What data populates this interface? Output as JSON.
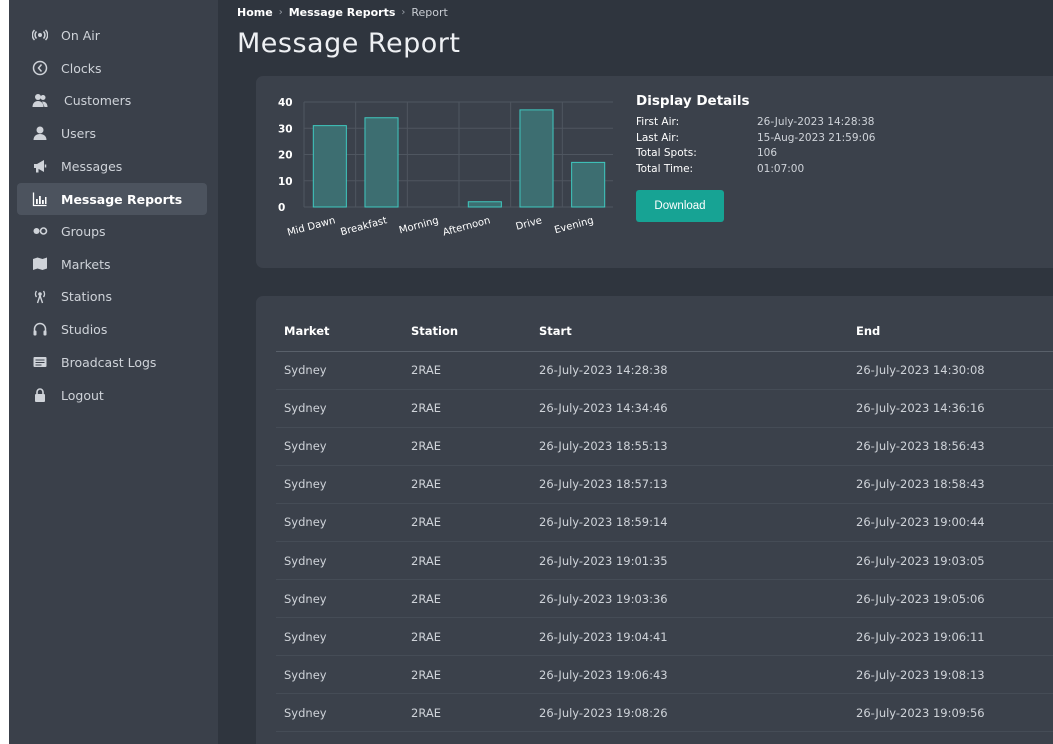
{
  "sidebar": {
    "items": [
      {
        "label": "On Air",
        "icon": "broadcast-icon"
      },
      {
        "label": "Clocks",
        "icon": "clock-icon"
      },
      {
        "label": "Customers",
        "icon": "customers-icon"
      },
      {
        "label": "Users",
        "icon": "user-icon"
      },
      {
        "label": "Messages",
        "icon": "megaphone-icon"
      },
      {
        "label": "Message Reports",
        "icon": "report-chart-icon",
        "active": true
      },
      {
        "label": "Groups",
        "icon": "groups-icon"
      },
      {
        "label": "Markets",
        "icon": "map-icon"
      },
      {
        "label": "Stations",
        "icon": "antenna-icon"
      },
      {
        "label": "Studios",
        "icon": "headset-icon"
      },
      {
        "label": "Broadcast Logs",
        "icon": "logbook-icon"
      },
      {
        "label": "Logout",
        "icon": "lock-icon"
      }
    ]
  },
  "breadcrumb": {
    "home": "Home",
    "reports": "Message Reports",
    "current": "Report"
  },
  "page": {
    "title": "Message Report"
  },
  "details": {
    "title": "Display Details",
    "first_air_label": "First Air:",
    "first_air": "26-July-2023 14:28:38",
    "last_air_label": "Last Air:",
    "last_air": "15-Aug-2023 21:59:06",
    "total_spots_label": "Total Spots:",
    "total_spots": "106",
    "total_time_label": "Total Time:",
    "total_time": "01:07:00",
    "download_label": "Download"
  },
  "chart_data": {
    "type": "bar",
    "categories": [
      "Mid Dawn",
      "Breakfast",
      "Morning",
      "Afternoon",
      "Drive",
      "Evening"
    ],
    "values": [
      31,
      34,
      0,
      2,
      37,
      17
    ],
    "yticks": [
      "0",
      "10",
      "20",
      "30",
      "40"
    ],
    "ylim": [
      0,
      40
    ],
    "grid": true,
    "bar_fill": "#3d6e71",
    "bar_stroke": "#3fc9c0"
  },
  "table": {
    "headers": [
      "Market",
      "Station",
      "Start",
      "End"
    ],
    "rows": [
      [
        "Sydney",
        "2RAE",
        "26-July-2023 14:28:38",
        "26-July-2023 14:30:08"
      ],
      [
        "Sydney",
        "2RAE",
        "26-July-2023 14:34:46",
        "26-July-2023 14:36:16"
      ],
      [
        "Sydney",
        "2RAE",
        "26-July-2023 18:55:13",
        "26-July-2023 18:56:43"
      ],
      [
        "Sydney",
        "2RAE",
        "26-July-2023 18:57:13",
        "26-July-2023 18:58:43"
      ],
      [
        "Sydney",
        "2RAE",
        "26-July-2023 18:59:14",
        "26-July-2023 19:00:44"
      ],
      [
        "Sydney",
        "2RAE",
        "26-July-2023 19:01:35",
        "26-July-2023 19:03:05"
      ],
      [
        "Sydney",
        "2RAE",
        "26-July-2023 19:03:36",
        "26-July-2023 19:05:06"
      ],
      [
        "Sydney",
        "2RAE",
        "26-July-2023 19:04:41",
        "26-July-2023 19:06:11"
      ],
      [
        "Sydney",
        "2RAE",
        "26-July-2023 19:06:43",
        "26-July-2023 19:08:13"
      ],
      [
        "Sydney",
        "2RAE",
        "26-July-2023 19:08:26",
        "26-July-2023 19:09:56"
      ]
    ]
  },
  "colors": {
    "accent": "#17a394",
    "sidebar_bg": "#3a404a",
    "main_bg": "#2f353e",
    "card_bg": "#3b414b"
  }
}
